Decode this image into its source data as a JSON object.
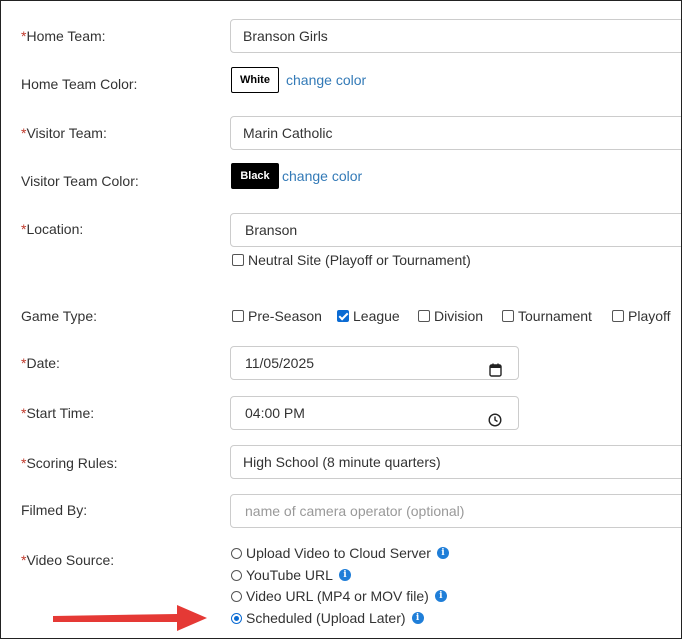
{
  "fields": {
    "home_team": {
      "required_mark": "*",
      "label": "Home Team:",
      "value": "Branson Girls"
    },
    "home_team_color": {
      "label": "Home Team Color:",
      "swatch": "White",
      "change_link": "change color"
    },
    "visitor_team": {
      "required_mark": "*",
      "label": "Visitor Team:",
      "value": "Marin Catholic"
    },
    "visitor_team_color": {
      "label": "Visitor Team Color:",
      "swatch": "Black",
      "change_link": "change color"
    },
    "location": {
      "required_mark": "*",
      "label": "Location:",
      "value": "Branson",
      "neutral_site_label": "Neutral Site (Playoff or Tournament)",
      "neutral_site_checked": false
    },
    "game_type": {
      "label": "Game Type:",
      "options": [
        {
          "label": "Pre-Season",
          "checked": false
        },
        {
          "label": "League",
          "checked": true
        },
        {
          "label": "Division",
          "checked": false
        },
        {
          "label": "Tournament",
          "checked": false
        },
        {
          "label": "Playoff",
          "checked": false
        }
      ]
    },
    "date": {
      "required_mark": "*",
      "label": "Date:",
      "value": "11/05/2025",
      "icon": "calendar-icon"
    },
    "start_time": {
      "required_mark": "*",
      "label": "Start Time:",
      "value": "04:00 PM",
      "icon": "clock-icon"
    },
    "scoring_rules": {
      "required_mark": "*",
      "label": "Scoring Rules:",
      "value": "High School (8 minute quarters)"
    },
    "filmed_by": {
      "label": "Filmed By:",
      "placeholder": "name of camera operator (optional)"
    },
    "video_source": {
      "required_mark": "*",
      "label": "Video Source:",
      "options": [
        {
          "label": "Upload Video to Cloud Server",
          "checked": false,
          "info": "i"
        },
        {
          "label": "YouTube URL",
          "checked": false,
          "info": "i"
        },
        {
          "label": "Video URL (MP4 or MOV file)",
          "checked": false,
          "info": "i"
        },
        {
          "label": "Scheduled (Upload Later)",
          "checked": true,
          "info": "i"
        }
      ]
    }
  },
  "colors": {
    "required": "#c0392b",
    "link": "#337ab7",
    "accent": "#0b6bd3",
    "arrow": "#e53935"
  }
}
